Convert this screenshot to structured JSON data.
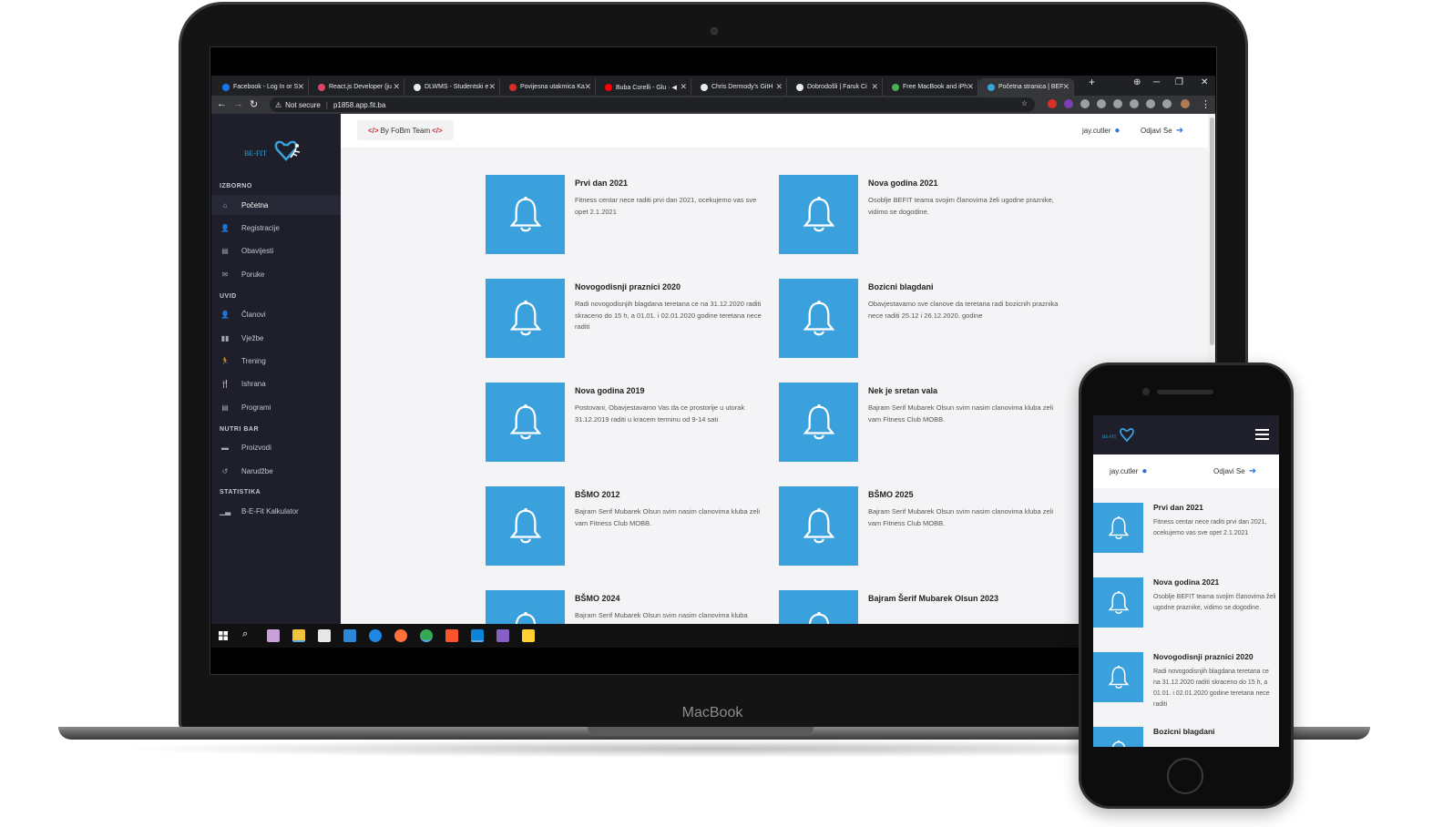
{
  "browser": {
    "tabs": [
      {
        "title": "Facebook - Log In or S",
        "color": "#1877f2"
      },
      {
        "title": "React.js Developer (ju",
        "color": "#e0415f"
      },
      {
        "title": "DLWMS - Studentski e",
        "color": "#e8eaed"
      },
      {
        "title": "Povijesna utakmica Ka",
        "color": "#d93025"
      },
      {
        "title": "Buba Corelli - Glu · ◀",
        "color": "#ff0000"
      },
      {
        "title": "Chris Dermody's GitH",
        "color": "#e8eaed"
      },
      {
        "title": "Dobrodošli | Faruk Ci",
        "color": "#e8eaed"
      },
      {
        "title": "Free MacBook and iPh",
        "color": "#4caf50"
      },
      {
        "title": "Početna stranica | BEF",
        "color": "#3aa1dc"
      }
    ],
    "url_security": "Not secure",
    "url": "p1858.app.fit.ba"
  },
  "sidebar": {
    "logo_text": "BE-FIT",
    "sections": [
      {
        "title": "IZBORNO",
        "items": [
          {
            "label": "Početna",
            "icon": "home-icon",
            "glyph": "⌂"
          },
          {
            "label": "Registracije",
            "icon": "user-plus-icon",
            "glyph": "👤"
          },
          {
            "label": "Obavijesti",
            "icon": "news-icon",
            "glyph": "▤"
          },
          {
            "label": "Poruke",
            "icon": "envelope-icon",
            "glyph": "✉"
          }
        ]
      },
      {
        "title": "UVID",
        "items": [
          {
            "label": "Članovi",
            "icon": "user-icon",
            "glyph": "👤"
          },
          {
            "label": "Vježbe",
            "icon": "dumbbell-icon",
            "glyph": "▮▮"
          },
          {
            "label": "Trening",
            "icon": "running-icon",
            "glyph": "🏃"
          },
          {
            "label": "Ishrana",
            "icon": "utensils-icon",
            "glyph": "🍴"
          },
          {
            "label": "Programi",
            "icon": "list-icon",
            "glyph": "▤"
          }
        ]
      },
      {
        "title": "NUTRI BAR",
        "items": [
          {
            "label": "Proizvodi",
            "icon": "products-icon",
            "glyph": "▬"
          },
          {
            "label": "Narudžbe",
            "icon": "history-icon",
            "glyph": "↺"
          }
        ]
      },
      {
        "title": "STATISTIKA",
        "items": [
          {
            "label": "B-E-Fit Kalkulator",
            "icon": "chart-icon",
            "glyph": "▁▃"
          }
        ]
      }
    ]
  },
  "topbar": {
    "team_label": "By FoBm Team",
    "username": "jay.cutler",
    "logout_label": "Odjavi Se"
  },
  "notifications": [
    {
      "title": "Prvi dan 2021",
      "text": "Fitness centar nece raditi prvi dan 2021, ocekujemo vas sve opet 2.1.2021"
    },
    {
      "title": "Nova godina 2021",
      "text": "Osoblje BEFIT teama svojim članovima želi ugodne praznike, vidimo se dogodine."
    },
    {
      "title": "Novogodisnji praznici 2020",
      "text": "Radi novogodisnjih blagdana teretana ce na 31.12.2020 raditi skraceno do 15 h, a 01.01. i 02.01.2020 godine teretana nece raditi"
    },
    {
      "title": "Bozicni blagdani",
      "text": "Obavjestavamo sve clanove da teretana radi bozicnih praznika nece raditi 25.12 i 26.12.2020. godine"
    },
    {
      "title": "Nova godina 2019",
      "text": "Postovani, Obavjestavamo Vas da ce prostorije u utorak 31.12.2019 raditi u kracem terminu od 9-14 sati"
    },
    {
      "title": "Nek je sretan vala",
      "text": "Bajram Serif Mubarek Olsun svim nasim clanovima kluba zeli vam Fitness Club MOBB."
    },
    {
      "title": "BŠMO 2012",
      "text": "Bajram Serif Mubarek Olsun svim nasim clanovima kluba zeli vam Fitness Club MOBB."
    },
    {
      "title": "BŠMO 2025",
      "text": "Bajram Serif Mubarek Olsun svim nasim clanovima kluba zeli vam Fitness Club MOBB."
    },
    {
      "title": "BŠMO 2024",
      "text": "Bajram Serif Mubarek Olsun svim nasim clanovima kluba"
    },
    {
      "title": "Bajram Šerif Mubarek Olsun 2023",
      "text": ""
    }
  ],
  "device": {
    "laptop_label": "MacBook"
  },
  "phone": {
    "logo_text": "BE-FIT",
    "username": "jay.cutler",
    "logout_label": "Odjavi Se",
    "notifications": [
      {
        "title": "Prvi dan 2021",
        "text": "Fitness centar nece raditi prvi dan 2021, ocekujemo vas sve opet 2.1.2021"
      },
      {
        "title": "Nova godina 2021",
        "text": "Osoblje BEFIT teama svojim članovima želi ugodne praznike, vidimo se dogodine."
      },
      {
        "title": "Novogodisnji praznici 2020",
        "text": "Radi novogodisnjih blagdana teretana ce na 31.12.2020 raditi skraceno do 15 h, a 01.01. i 02.01.2020 godine teretana nece raditi"
      },
      {
        "title": "Bozicni blagdani",
        "text": ""
      }
    ]
  },
  "colors": {
    "accent": "#3aa1dc",
    "sidebar": "#1e1f2b",
    "user_icon": "#2c72d8"
  }
}
